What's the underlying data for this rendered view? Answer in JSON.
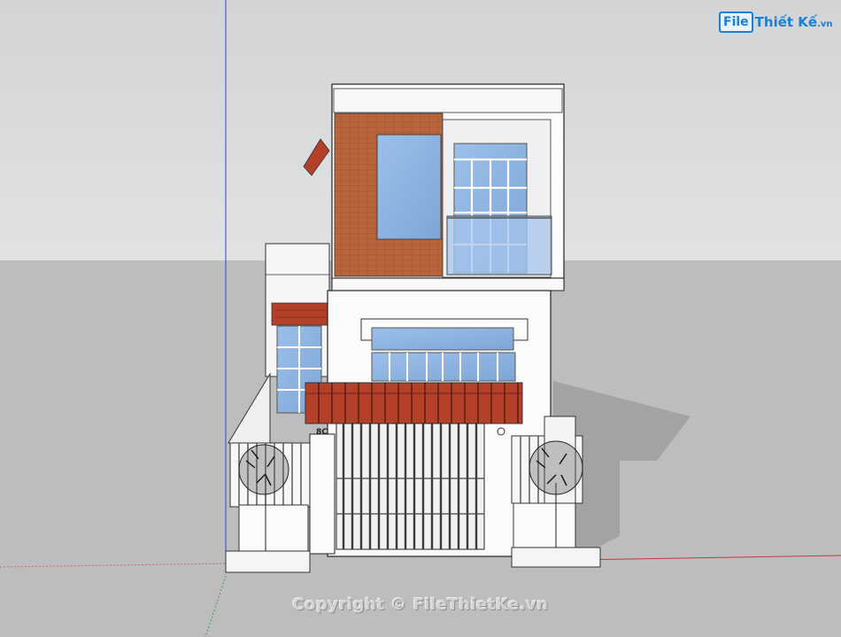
{
  "logo": {
    "badge": "File",
    "name": "Thiết Kế",
    "tld": ".vn"
  },
  "house": {
    "number": "8C"
  },
  "watermark": {
    "text": "Copyright © FileThietKe.vn"
  },
  "colors": {
    "sky": "#d6d8da",
    "ground": "#bdbdbd",
    "brick": "#b8653b",
    "roof_tile": "#b4402a",
    "glass": "#8fb4e0",
    "wall": "#fbfbfb",
    "shadow": "#a3a3a3",
    "logo_blue": "#1b7fd6"
  }
}
